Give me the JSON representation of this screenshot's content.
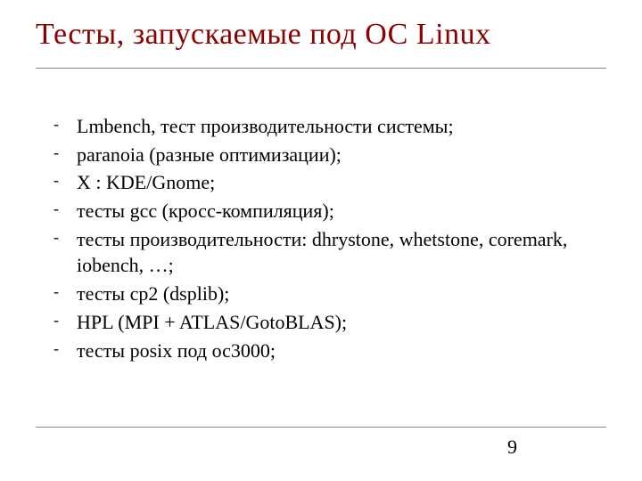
{
  "title": "Тесты, запускаемые под ОС Linux",
  "items": [
    "Lmbench, тест производительности системы;",
    "paranoia (разные оптимизации);",
    "X : KDE/Gnome;",
    "тесты gcc (кросс-компиляция);",
    "тесты производительности: dhrystone, whetstone, coremark, iobench, …;",
    "тесты ср2 (dsplib);",
    "HPL (MPI + ATLAS/GotoBLAS);",
    "тесты posix под ос3000;"
  ],
  "pageNumber": "9"
}
